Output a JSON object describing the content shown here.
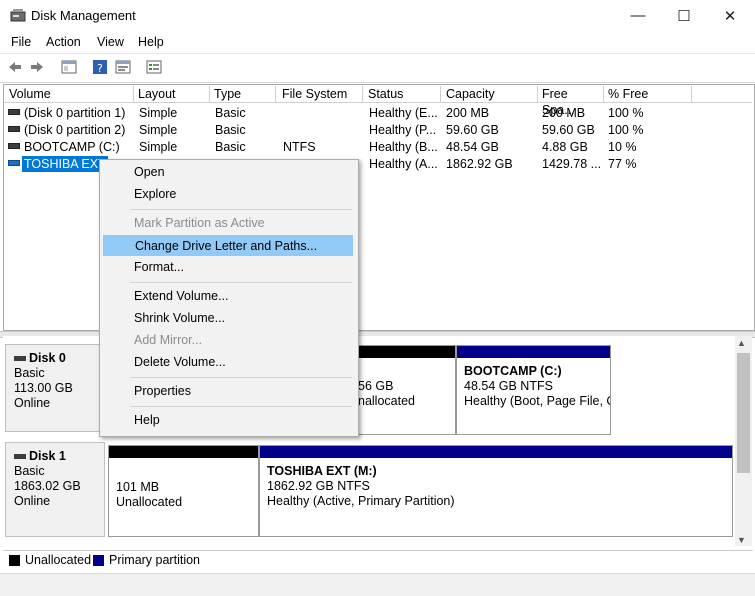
{
  "window": {
    "title": "Disk Management"
  },
  "menu": [
    "File",
    "Action",
    "View",
    "Help"
  ],
  "list": {
    "columns": [
      "Volume",
      "Layout",
      "Type",
      "File System",
      "Status",
      "Capacity",
      "Free Spa...",
      "% Free"
    ],
    "rows": [
      {
        "volume": "(Disk 0 partition 1)",
        "layout": "Simple",
        "type": "Basic",
        "fs": "",
        "status": "Healthy (E...",
        "capacity": "200 MB",
        "free": "200 MB",
        "pct": "100 %"
      },
      {
        "volume": "(Disk 0 partition 2)",
        "layout": "Simple",
        "type": "Basic",
        "fs": "",
        "status": "Healthy (P...",
        "capacity": "59.60 GB",
        "free": "59.60 GB",
        "pct": "100 %"
      },
      {
        "volume": "BOOTCAMP (C:)",
        "layout": "Simple",
        "type": "Basic",
        "fs": "NTFS",
        "status": "Healthy (B...",
        "capacity": "48.54 GB",
        "free": "4.88 GB",
        "pct": "10 %"
      },
      {
        "volume": "TOSHIBA EXT",
        "layout": "",
        "type": "",
        "fs": "",
        "status": "Healthy (A...",
        "capacity": "1862.92 GB",
        "free": "1429.78 ...",
        "pct": "77 %"
      }
    ]
  },
  "context_menu": {
    "items": [
      "Open",
      "Explore",
      "Mark Partition as Active",
      "Change Drive Letter and Paths...",
      "Format...",
      "Extend Volume...",
      "Shrink Volume...",
      "Add Mirror...",
      "Delete Volume...",
      "Properties",
      "Help"
    ]
  },
  "disks": [
    {
      "name": "Disk 0",
      "kind": "Basic",
      "size": "113.00 GB",
      "state": "Online",
      "partitions": [
        {
          "line1": "56 GB",
          "line2": "nallocated"
        },
        {
          "name": "BOOTCAMP  (C:)",
          "line1": "48.54 GB NTFS",
          "line2": "Healthy (Boot, Page File, C"
        }
      ]
    },
    {
      "name": "Disk 1",
      "kind": "Basic",
      "size": "1863.02 GB",
      "state": "Online",
      "partitions": [
        {
          "line1": "101 MB",
          "line2": "Unallocated"
        },
        {
          "name": "TOSHIBA EXT  (M:)",
          "line1": "1862.92 GB NTFS",
          "line2": "Healthy (Active, Primary Partition)"
        }
      ]
    }
  ],
  "legend": {
    "unallocated": "Unallocated",
    "primary": "Primary partition"
  },
  "colors": {
    "primary": "#00008b",
    "unallocated": "#000000",
    "selection": "#0078d7",
    "menu_hover": "#91c9f7"
  }
}
